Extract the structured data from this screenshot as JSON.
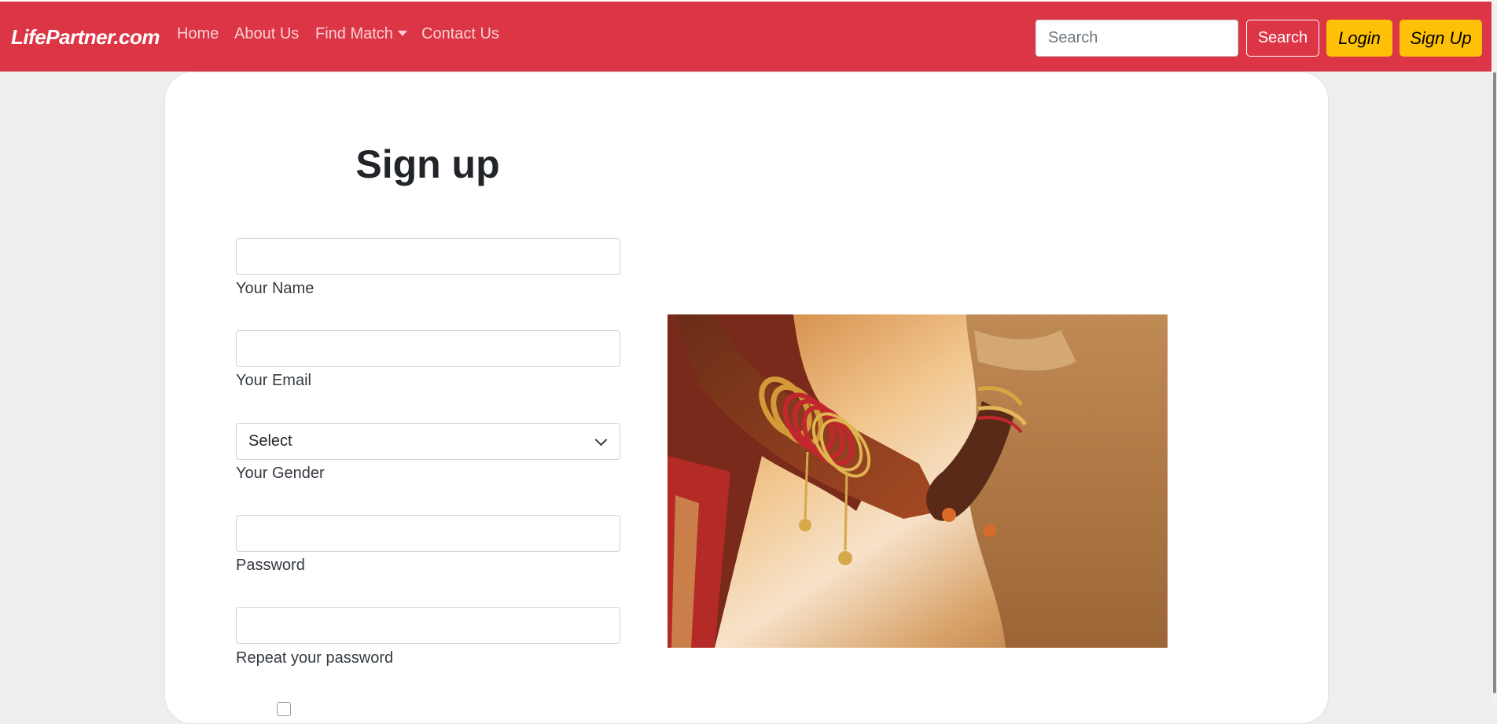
{
  "brand": "LifePartner.com",
  "nav": {
    "home": "Home",
    "about": "About Us",
    "find_match": "Find Match",
    "contact": "Contact Us"
  },
  "search": {
    "placeholder": "Search",
    "button": "Search"
  },
  "auth": {
    "login": "Login",
    "signup": "Sign Up"
  },
  "form": {
    "title": "Sign up",
    "name_label": "Your Name",
    "email_label": "Your Email",
    "gender_value": "Select",
    "gender_label": "Your Gender",
    "password_label": "Password",
    "repeat_password_label": "Repeat your password"
  },
  "image": {
    "alt": "wedding-hands-photo"
  },
  "colors": {
    "navbar": "#dc3545",
    "accent_button": "#ffc107",
    "page_background": "#eeeeee"
  }
}
